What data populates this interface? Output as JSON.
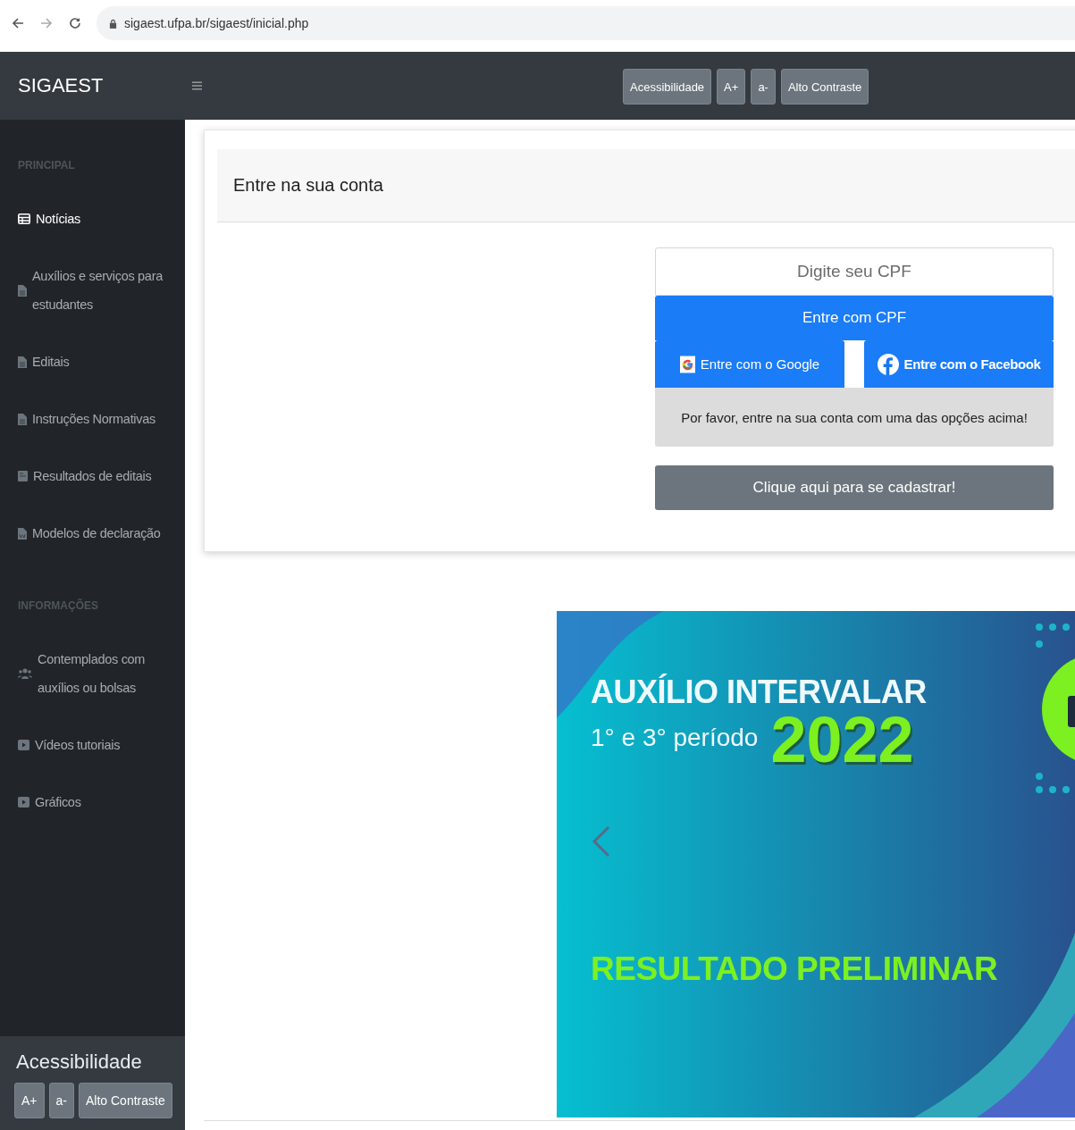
{
  "browser": {
    "url": "sigaest.ufpa.br/sigaest/inicial.php"
  },
  "navbar": {
    "brand": "SIGAEST",
    "buttons": [
      "Acessibilidade",
      "A+",
      "a-",
      "Alto Contraste"
    ]
  },
  "sidebar": {
    "sections": [
      {
        "heading": "PRINCIPAL",
        "items": [
          {
            "label": "Notícias",
            "kind": "table",
            "selected": true
          },
          {
            "label": "Auxílios e serviços para estudantes",
            "kind": "file",
            "selected": false
          },
          {
            "label": "Editais",
            "kind": "file",
            "selected": false
          },
          {
            "label": "Instruções Normativas",
            "kind": "file",
            "selected": false
          },
          {
            "label": "Resultados de editais",
            "kind": "sheet",
            "selected": false
          },
          {
            "label": "Modelos de declaração",
            "kind": "word",
            "selected": false
          }
        ]
      },
      {
        "heading": "INFORMAÇÕES",
        "items": [
          {
            "label": "Contemplados com auxílios ou bolsas",
            "kind": "users",
            "selected": false
          },
          {
            "label": "Vídeos tutoriais",
            "kind": "video",
            "selected": false
          },
          {
            "label": "Gráficos",
            "kind": "video",
            "selected": false
          }
        ]
      }
    ],
    "accessibility": {
      "title": "Acessibilidade",
      "buttons": [
        "A+",
        "a-",
        "Alto Contraste"
      ]
    }
  },
  "login": {
    "title": "Entre na sua conta",
    "cpf_field": {
      "placeholder": "Digite seu CPF"
    },
    "cpf_button": "Entre com CPF",
    "google_button": "Entre com o Google",
    "facebook_button": "Entre com o Facebook",
    "message": "Por favor, entre na sua conta com uma das opções acima!",
    "register_button": "Clique aqui para se cadastrar!"
  },
  "banner": {
    "title": "AUXÍLIO INTERVALAR",
    "subtitle": "1° e 3° período",
    "year": "2022",
    "result": "RESULTADO PRELIMINAR"
  }
}
